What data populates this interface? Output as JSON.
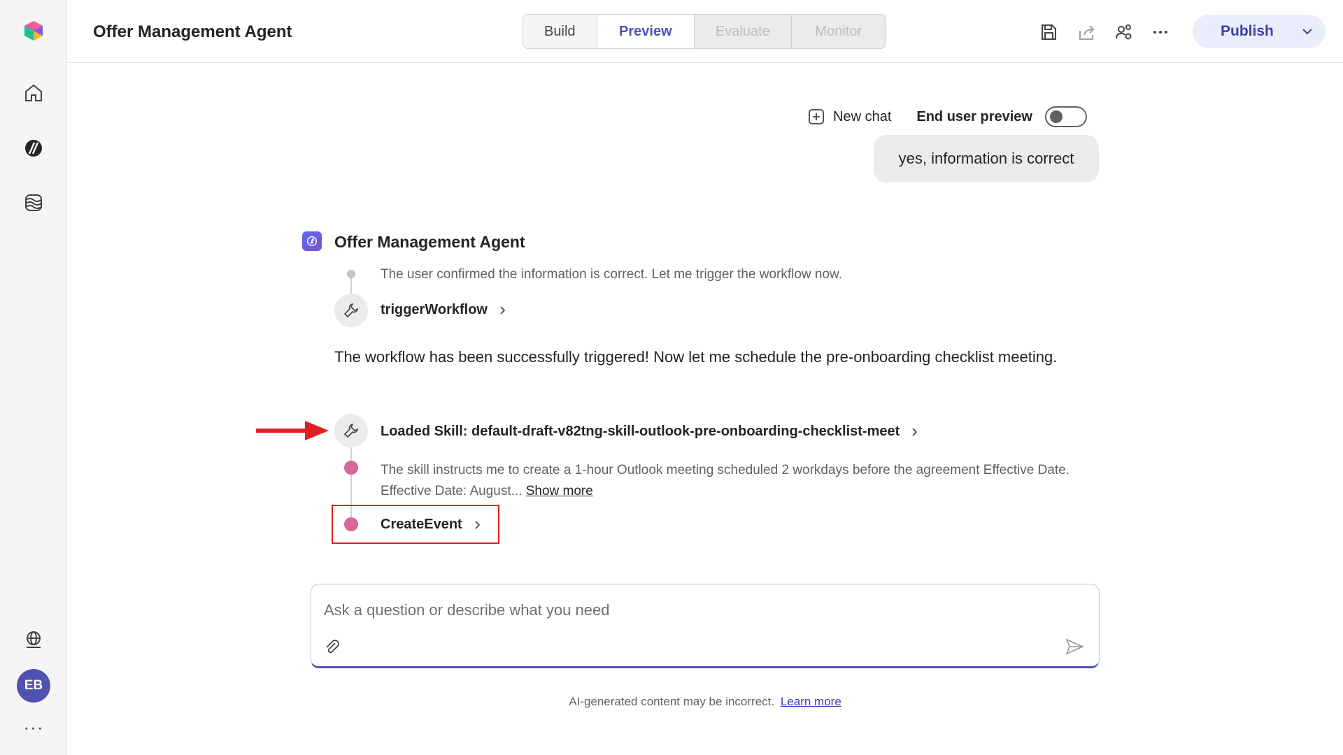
{
  "app": {
    "title": "Offer Management Agent"
  },
  "tabs": [
    {
      "label": "Build",
      "state": "enabled"
    },
    {
      "label": "Preview",
      "state": "selected"
    },
    {
      "label": "Evaluate",
      "state": "disabled"
    },
    {
      "label": "Monitor",
      "state": "disabled"
    }
  ],
  "header_icons": [
    "save-icon",
    "share-icon",
    "people-settings-icon",
    "more-icon"
  ],
  "publish": {
    "label": "Publish"
  },
  "rail": {
    "icons": [
      "home-icon",
      "agent-icon",
      "knowledge-icon",
      "globe-settings-icon"
    ],
    "avatar_initials": "EB"
  },
  "chat": {
    "new_chat_label": "New chat",
    "end_user_preview_label": "End user preview",
    "end_user_preview_on": false,
    "user_message": "yes, information is correct",
    "agent_name": "Offer Management Agent",
    "thought_1": "The user confirmed the information is correct. Let me trigger the workflow now.",
    "tool_1": "triggerWorkflow",
    "agent_message": "The workflow has been successfully triggered! Now let me schedule the pre-onboarding checklist meeting.",
    "tool_2": "Loaded Skill: default-draft-v82tng-skill-outlook-pre-onboarding-checklist-meet",
    "thought_2": "The skill instructs me to create a 1-hour Outlook meeting scheduled 2 workdays before the agreement Effective Date. Effective Date: August...",
    "show_more": "Show more",
    "tool_3": "CreateEvent"
  },
  "composer": {
    "placeholder": "Ask a question or describe what you need",
    "value": ""
  },
  "footer": {
    "disclaimer": "AI-generated content may be incorrect.",
    "learn_more": "Learn more"
  },
  "colors": {
    "accent": "#4f52b2",
    "step_dot": "#d9669a",
    "annotation": "#e02020"
  }
}
